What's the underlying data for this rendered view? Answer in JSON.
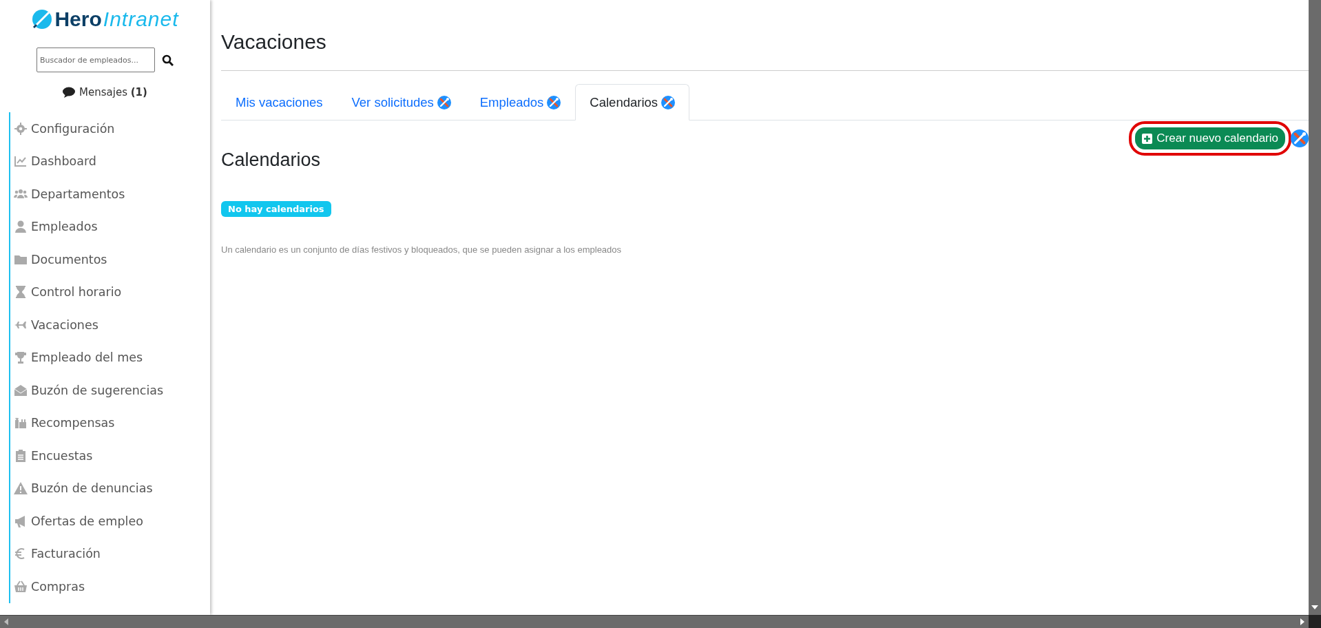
{
  "logo": {
    "brand": "Hero",
    "product": "Intranet"
  },
  "search": {
    "placeholder": "Buscador de empleados..."
  },
  "messages": {
    "label": "Mensajes **(1)**"
  },
  "sidebar": {
    "items": [
      {
        "label": "Configuración"
      },
      {
        "label": "Dashboard"
      },
      {
        "label": "Departamentos"
      },
      {
        "label": "Empleados"
      },
      {
        "label": "Documentos"
      },
      {
        "label": "Control horario"
      },
      {
        "label": "Vacaciones"
      },
      {
        "label": "Empleado del mes"
      },
      {
        "label": "Buzón de sugerencias"
      },
      {
        "label": "Recompensas"
      },
      {
        "label": "Encuestas"
      },
      {
        "label": "Buzón de denuncias"
      },
      {
        "label": "Ofertas de empleo"
      },
      {
        "label": "Facturación"
      },
      {
        "label": "Compras"
      }
    ]
  },
  "page": {
    "title": "Vacaciones"
  },
  "tabs": [
    {
      "label": "Mis vacaciones",
      "selected": false,
      "admin_tool": false
    },
    {
      "label": "Ver solicitudes",
      "selected": false,
      "admin_tool": true
    },
    {
      "label": "Empleados",
      "selected": false,
      "admin_tool": true
    },
    {
      "label": "Calendarios",
      "selected": true,
      "admin_tool": true
    }
  ],
  "section": {
    "title": "Calendarios",
    "badge": "No hay calendarios",
    "description": "Un calendario es un conjunto de días festivos y bloqueados, que se pueden asignar a los empleados"
  },
  "create_button": {
    "label": "Crear nuevo calendario",
    "highlighted": true,
    "admin_tool": true
  }
}
